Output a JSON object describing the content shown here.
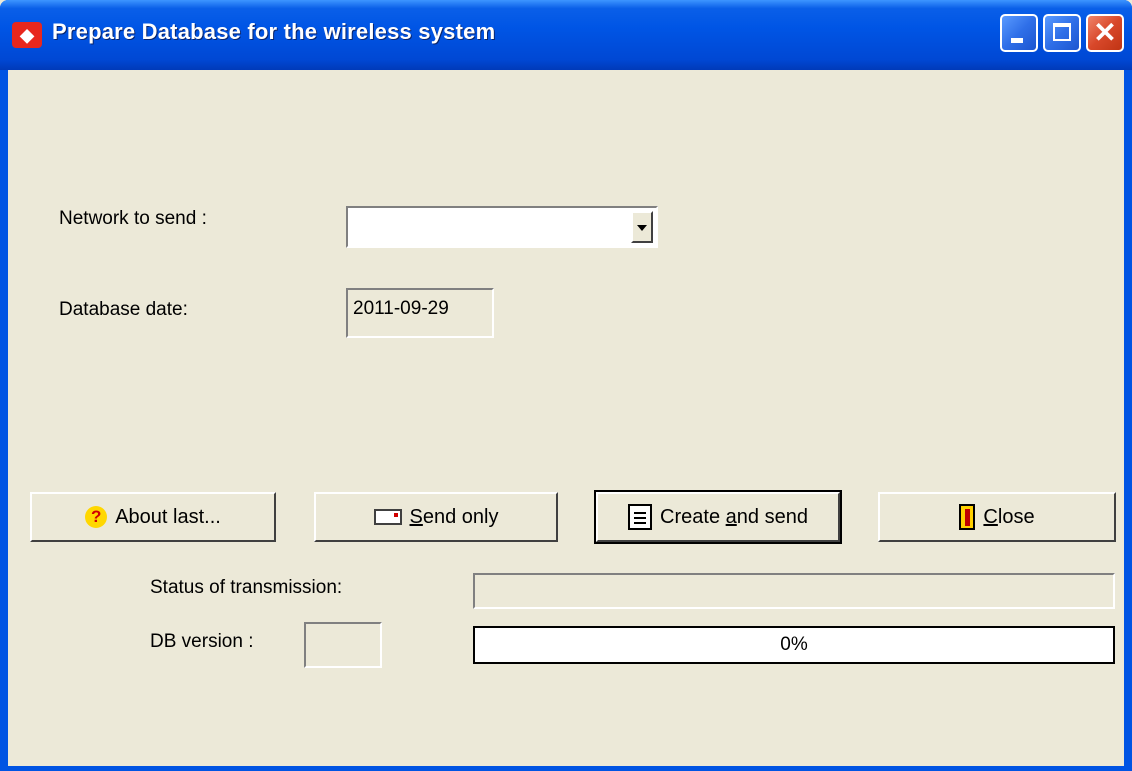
{
  "window": {
    "title": "Prepare Database for the wireless system",
    "controls": {
      "minimize": "minimize-icon",
      "maximize": "maximize-icon",
      "close": "close-icon"
    },
    "close_glyph": "✕"
  },
  "form": {
    "network_label": "Network to send :",
    "network_value": "",
    "date_label": "Database date:",
    "date_value": "2011-09-29"
  },
  "buttons": {
    "about_label": "About last...",
    "send_only_prefix": "",
    "send_only_underlined": "S",
    "send_only_rest": "end only",
    "create_prefix": "Create ",
    "create_underlined": "a",
    "create_rest": "nd send",
    "close_underlined": "C",
    "close_rest": "lose"
  },
  "status": {
    "transmission_label": "Status of transmission:",
    "transmission_value": "",
    "db_version_label": "DB version :",
    "db_version_value": "",
    "progress_percent": 0,
    "progress_text": "0%"
  },
  "colors": {
    "titlebar": "#0055e5",
    "dialog_bg": "#ece9d8",
    "close_button": "#d8482a",
    "progress_fill": "#000080"
  }
}
